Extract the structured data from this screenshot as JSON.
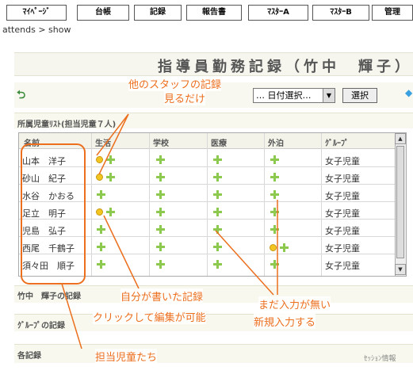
{
  "nav": {
    "items": [
      "ﾏｲﾍﾟｰｼﾞ",
      "台帳",
      "記録",
      "報告書",
      "ﾏｽﾀｰA",
      "ﾏｽﾀｰB",
      "管理"
    ]
  },
  "breadcrumb": "attends > show",
  "title": "指導員勤務記録（竹中　輝子）",
  "toolbar": {
    "date_select": "… 日付選択…",
    "select_button": "選択"
  },
  "section_child_list": "所属児童ﾘｽﾄ(担当児童７人)",
  "table": {
    "columns": [
      "名前",
      "生活",
      "学校",
      "医療",
      "外泊",
      "ｸﾞﾙｰﾌﾟ"
    ],
    "rows": [
      {
        "name": "山本　洋子",
        "group": "女子児童"
      },
      {
        "name": "砂山　紀子",
        "group": "女子児童"
      },
      {
        "name": "水谷　かおる",
        "group": "女子児童"
      },
      {
        "name": "足立　明子",
        "group": "女子児童"
      },
      {
        "name": "児島　弘子",
        "group": "女子児童"
      },
      {
        "name": "西尾　千鶴子",
        "group": "女子児童"
      },
      {
        "name": "須々田　順子",
        "group": "女子児童"
      }
    ]
  },
  "section_staff": "竹中　輝子の記録",
  "section_group": "ｸﾞﾙｰﾌﾟの記録",
  "section_each": "各記録",
  "session_info": "ｾｯｼｮﾝ情報 ",
  "annotations": {
    "others_records": "他のスタッフの記録",
    "view_only": "見るだけ",
    "my_records": "自分が書いた記録",
    "click_edit": "クリックして編集が可能",
    "no_input": "まだ入力が無い",
    "new_input": "新規入力する",
    "assigned": "担当児童たち"
  },
  "colors": {
    "annotation": "#ec6f1e",
    "plus": "#8ec94f",
    "smile": "#f2c521"
  }
}
